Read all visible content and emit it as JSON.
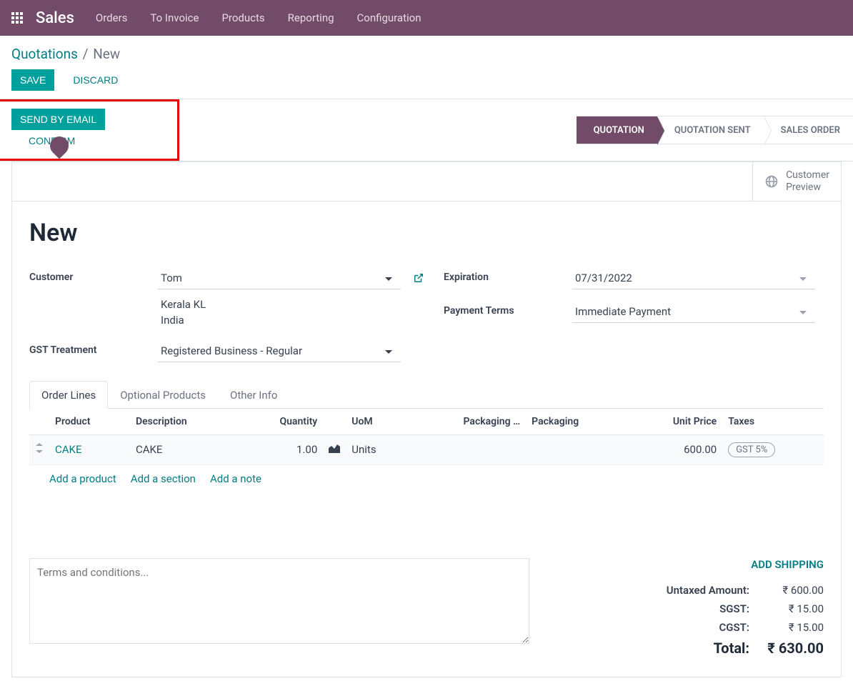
{
  "nav": {
    "module": "Sales",
    "items": [
      "Orders",
      "To Invoice",
      "Products",
      "Reporting",
      "Configuration"
    ]
  },
  "breadcrumb": {
    "root": "Quotations",
    "current": "New"
  },
  "actions": {
    "save": "SAVE",
    "discard": "DISCARD"
  },
  "statusbar": {
    "send_by_email": "SEND BY EMAIL",
    "confirm": "CONFIRM",
    "stages": [
      "QUOTATION",
      "QUOTATION SENT",
      "SALES ORDER"
    ],
    "active_stage": 0
  },
  "stat_button": {
    "label_l1": "Customer",
    "label_l2": "Preview"
  },
  "record": {
    "title": "New"
  },
  "fields": {
    "customer_label": "Customer",
    "customer_value": "Tom",
    "address_l1": "Kerala KL",
    "address_l2": "India",
    "gst_label": "GST Treatment",
    "gst_value": "Registered Business - Regular",
    "expiration_label": "Expiration",
    "expiration_value": "07/31/2022",
    "terms_label": "Payment Terms",
    "terms_value": "Immediate Payment"
  },
  "tabs": [
    "Order Lines",
    "Optional Products",
    "Other Info"
  ],
  "table": {
    "headers": {
      "product": "Product",
      "description": "Description",
      "quantity": "Quantity",
      "uom": "UoM",
      "pkg_qty": "Packaging …",
      "pkg": "Packaging",
      "unit_price": "Unit Price",
      "taxes": "Taxes"
    },
    "rows": [
      {
        "product": "CAKE",
        "description": "CAKE",
        "quantity": "1.00",
        "uom": "Units",
        "unit_price": "600.00",
        "tax": "GST 5%"
      }
    ],
    "add_product": "Add a product",
    "add_section": "Add a section",
    "add_note": "Add a note"
  },
  "terms_placeholder": "Terms and conditions...",
  "totals": {
    "add_shipping": "ADD SHIPPING",
    "untaxed_label": "Untaxed Amount:",
    "untaxed_value": "₹ 600.00",
    "sgst_label": "SGST:",
    "sgst_value": "₹ 15.00",
    "cgst_label": "CGST:",
    "cgst_value": "₹ 15.00",
    "total_label": "Total:",
    "total_value": "₹ 630.00"
  }
}
